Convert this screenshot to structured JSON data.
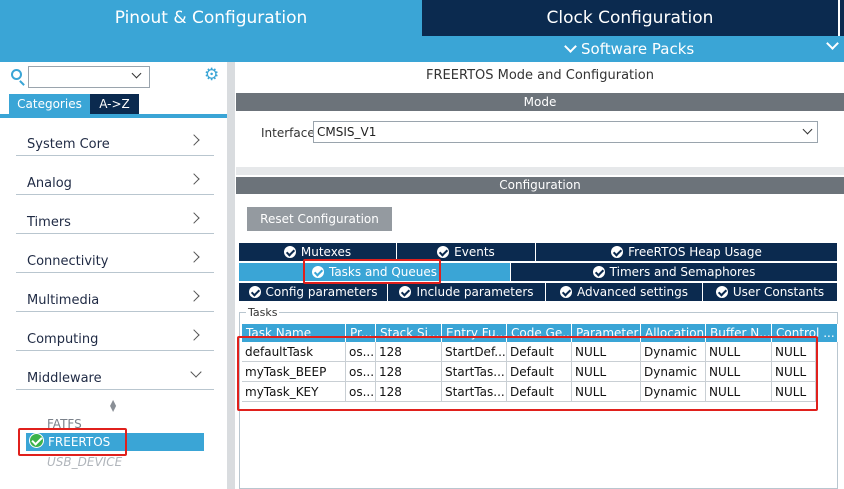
{
  "top_tabs": {
    "pinout": "Pinout & Configuration",
    "clock": "Clock Configuration"
  },
  "software_packs": "Software Packs",
  "left": {
    "search": {
      "value": "",
      "placeholder": ""
    },
    "tabs": {
      "categories": "Categories",
      "az": "A->Z"
    },
    "categories": [
      "System Core",
      "Analog",
      "Timers",
      "Connectivity",
      "Multimedia",
      "Computing",
      "Middleware"
    ],
    "middleware_items": {
      "fatfs": "FATFS",
      "freertos": "FREERTOS",
      "usb_device": "USB_DEVICE"
    }
  },
  "right": {
    "title": "FREERTOS Mode and Configuration",
    "mode_label": "Mode",
    "interface_label": "Interface",
    "interface_value": "CMSIS_V1",
    "config_label": "Configuration",
    "reset_button": "Reset Configuration",
    "tabs_row1": [
      "Mutexes",
      "Events",
      "FreeRTOS Heap Usage"
    ],
    "tabs_row2": [
      "Tasks and Queues",
      "Timers and Semaphores"
    ],
    "tabs_row3": [
      "Config parameters",
      "Include parameters",
      "Advanced settings",
      "User Constants"
    ],
    "tasks_group_label": "Tasks",
    "table": {
      "columns": [
        "Task Name",
        "Pr...",
        "Stack Si...",
        "Entry Fu...",
        "Code Ge...",
        "Parameter",
        "Allocation",
        "Buffer N...",
        "Control ..."
      ],
      "rows": [
        [
          "defaultTask",
          "os...",
          "128",
          "StartDef...",
          "Default",
          "NULL",
          "Dynamic",
          "NULL",
          "NULL"
        ],
        [
          "myTask_BEEP",
          "os...",
          "128",
          "StartTas...",
          "Default",
          "NULL",
          "Dynamic",
          "NULL",
          "NULL"
        ],
        [
          "myTask_KEY",
          "os...",
          "128",
          "StartTas...",
          "Default",
          "NULL",
          "Dynamic",
          "NULL",
          "NULL"
        ]
      ]
    }
  },
  "colors": {
    "accent": "#3aa5d6",
    "dark": "#0b2a4f",
    "highlight": "#e0201c",
    "check": "#3cb34a"
  }
}
